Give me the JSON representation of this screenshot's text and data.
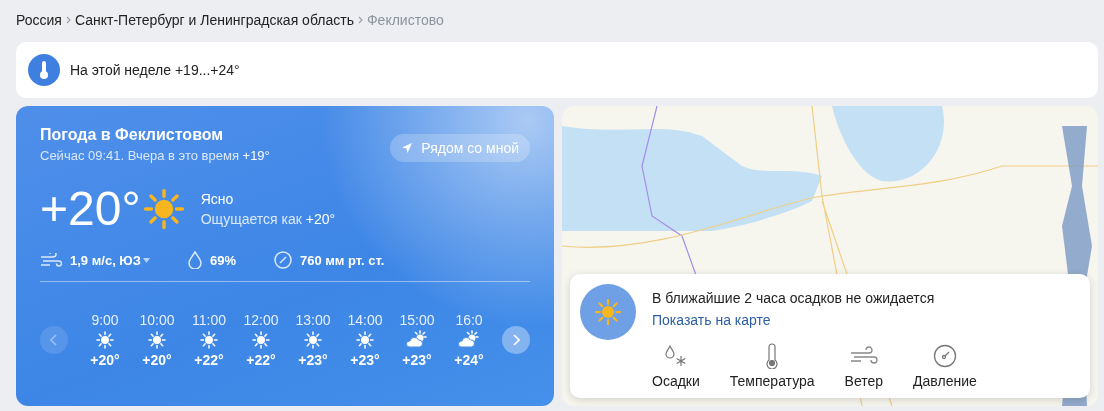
{
  "breadcrumbs": [
    {
      "label": "Россия",
      "current": false
    },
    {
      "label": "Санкт-Петербург и Ленинградская область",
      "current": false
    },
    {
      "label": "Феклистово",
      "current": true
    }
  ],
  "week_summary": {
    "text": "На этой неделе +19...+24°"
  },
  "current": {
    "title": "Погода в Феклистовом",
    "subtitle": "Сейчас 09:41. Вчера в это время",
    "yesterday_temp": "+19°",
    "nearby_button": "Рядом со мной",
    "temperature": "+20°",
    "condition": "Ясно",
    "feels_like_label": "Ощущается как",
    "feels_like": "+20°",
    "wind": "1,9 м/с, ЮЗ",
    "humidity": "69%",
    "pressure": "760 мм рт. ст."
  },
  "hourly": {
    "prev_disabled": true,
    "next_disabled": false,
    "items": [
      {
        "time": "9:00",
        "kind": "sun",
        "temp": "+20°"
      },
      {
        "time": "10:00",
        "kind": "sun",
        "temp": "+20°"
      },
      {
        "time": "11:00",
        "kind": "sun",
        "temp": "+22°"
      },
      {
        "time": "12:00",
        "kind": "sun",
        "temp": "+22°"
      },
      {
        "time": "13:00",
        "kind": "sun",
        "temp": "+23°"
      },
      {
        "time": "14:00",
        "kind": "sun",
        "temp": "+23°"
      },
      {
        "time": "15:00",
        "kind": "partly-cloudy",
        "temp": "+23°"
      },
      {
        "time": "16:0",
        "kind": "partly-cloudy",
        "temp": "+24°"
      }
    ]
  },
  "map_popup": {
    "message": "В ближайшие 2 часа осадков не ожидается",
    "link": "Показать на карте",
    "layers": [
      {
        "kind": "precipitation",
        "label": "Осадки"
      },
      {
        "kind": "temperature",
        "label": "Температура"
      },
      {
        "kind": "wind",
        "label": "Ветер"
      },
      {
        "kind": "pressure",
        "label": "Давление"
      }
    ]
  }
}
